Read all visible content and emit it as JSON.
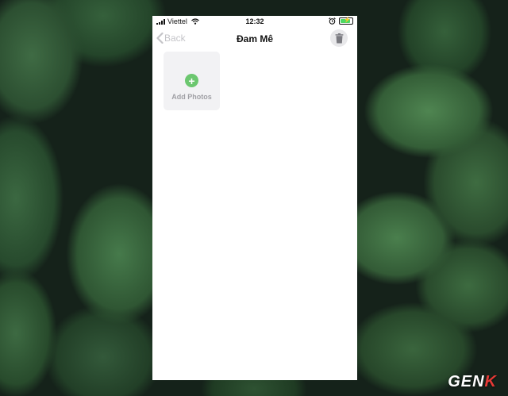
{
  "status_bar": {
    "carrier": "Viettel",
    "time": "12:32"
  },
  "nav": {
    "back_label": "Back",
    "title": "Đam Mê"
  },
  "album": {
    "add_photos_label": "Add Photos"
  },
  "watermark": {
    "prefix": "GEN",
    "accent": "K"
  },
  "colors": {
    "accent_green": "#6cc76f",
    "battery_green": "#4cd964",
    "back_gray": "#c4c4c8"
  }
}
